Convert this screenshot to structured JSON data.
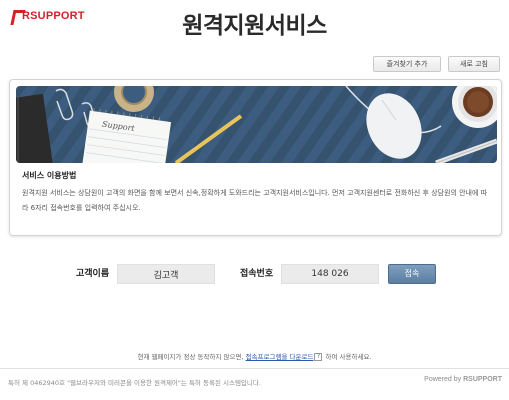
{
  "header": {
    "logo_text": "RSUPPORT",
    "title": "원격지원서비스"
  },
  "toolbar": {
    "favorite_label": "즐겨찾기 추가",
    "refresh_label": "새로 고침"
  },
  "banner": {
    "notebook_text": "Support"
  },
  "service": {
    "title": "서비스 이용방법",
    "description": "원격지원 서비스는 상담원이 고객의 화면을 함께 보면서 신속,정확하게 도와드리는 고객지원서비스입니다. 먼저 고객지원센터로 전화하신 후 상담원의 안내에 따라 6자리 접속번호를 입력하여 주십시오."
  },
  "form": {
    "name_label": "고객이름",
    "name_value": "김고객",
    "code_label": "접속번호",
    "code_value": "148 026",
    "connect_label": "접속"
  },
  "notice": {
    "prefix": "현재 웹페이지가 정상 동작하지 않으면,",
    "link": "접속프로그램을 다운로드",
    "help_glyph": "?",
    "suffix": "하여 사용하세요."
  },
  "footer": {
    "patent": "특허 제 0462940호 \"웹브라우저와 미러콘을 이용한 원격제어\"는 특허 등록된 시스템입니다.",
    "powered_prefix": "Powered by",
    "powered_brand": "RSUPPORT"
  },
  "colors": {
    "brand_red": "#d62027",
    "button_blue": "#6a8cae",
    "banner_blue": "#3b5b7d",
    "link_blue": "#2a59a8"
  }
}
